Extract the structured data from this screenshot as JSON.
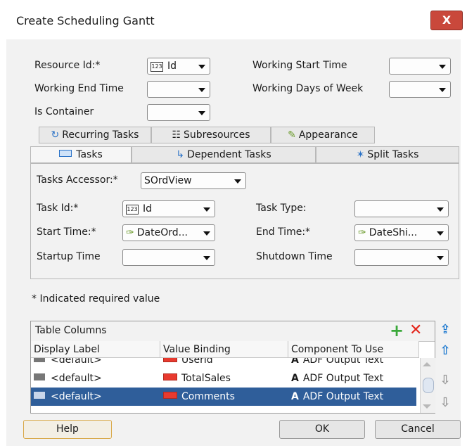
{
  "dialog": {
    "title": "Create Scheduling Gantt",
    "close_glyph": "X"
  },
  "form": {
    "resource_id_label": "Resource Id:*",
    "resource_id_value": "Id",
    "working_start_label": "Working Start Time",
    "working_end_label": "Working End Time",
    "working_days_label": "Working Days of Week",
    "is_container_label": "Is Container"
  },
  "tabs_row1": [
    "Recurring Tasks",
    "Subresources",
    "Appearance"
  ],
  "tabs_row2": [
    "Tasks",
    "Dependent Tasks",
    "Split Tasks"
  ],
  "tasks_panel": {
    "accessor_label": "Tasks Accessor:*",
    "accessor_value": "SOrdView",
    "task_id_label": "Task Id:*",
    "task_id_value": "Id",
    "task_type_label": "Task Type:",
    "start_time_label": "Start Time:*",
    "start_time_value": "DateOrd...",
    "end_time_label": "End Time:*",
    "end_time_value": "DateShi...",
    "startup_label": "Startup Time",
    "shutdown_label": "Shutdown Time"
  },
  "required_note": "* Indicated required value",
  "table": {
    "title": "Table Columns",
    "headers": [
      "Display Label",
      "Value Binding",
      "Component To Use"
    ],
    "rows": [
      {
        "label": "<default>",
        "binding": "Userid",
        "component": "ADF Output Text"
      },
      {
        "label": "<default>",
        "binding": "TotalSales",
        "component": "ADF Output Text"
      },
      {
        "label": "<default>",
        "binding": "Comments",
        "component": "ADF Output Text"
      }
    ],
    "selected_row": 2
  },
  "buttons": {
    "help": "Help",
    "ok": "OK",
    "cancel": "Cancel"
  },
  "colors": {
    "selection": "#2f5e9a",
    "add": "#3aa83a",
    "delete": "#e3261c",
    "arrow_active": "#1f7ad0",
    "arrow_inactive": "#9a9a9a"
  },
  "icons": {
    "add": "plus-icon",
    "delete": "x-icon",
    "move_top": "double-up-arrow-icon",
    "move_up": "up-arrow-icon",
    "move_down": "down-arrow-icon",
    "move_bottom": "double-down-arrow-icon"
  }
}
